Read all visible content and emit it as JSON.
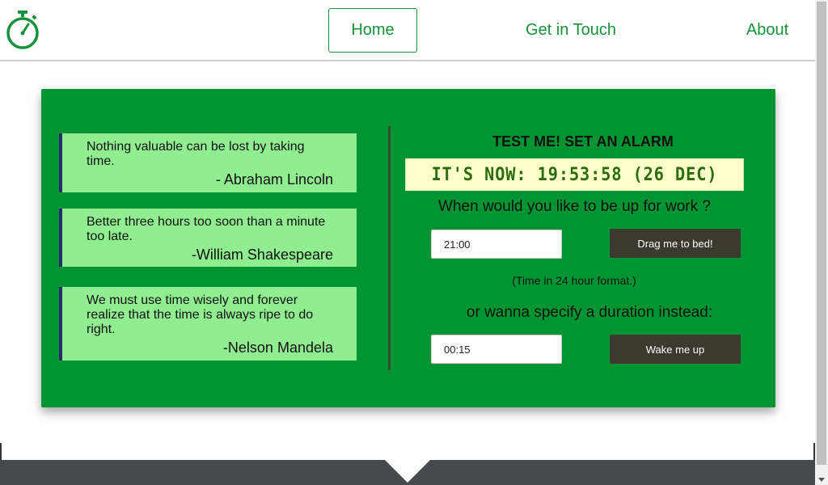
{
  "header": {
    "logo_icon": "stopwatch-icon",
    "nav": [
      {
        "label": "Home",
        "active": true
      },
      {
        "label": "Get in Touch"
      },
      {
        "label": "About"
      }
    ]
  },
  "quotes": [
    {
      "text": "Nothing valuable can be lost by taking time.",
      "author": "- Abraham Lincoln"
    },
    {
      "text": "Better three hours too soon than a minute too late.",
      "author": "-William Shakespeare"
    },
    {
      "text": "We must use time wisely and forever realize that the time is always ripe to do right.",
      "author": "-Nelson Mandela"
    }
  ],
  "alarm": {
    "title": "TEST ME! SET AN ALARM",
    "clock": "IT'S NOW: 19:53:58 (26 DEC)",
    "question": "When would you like to be up for work ?",
    "time_value": "21:00",
    "time_button": "Drag me to bed!",
    "hint": "(Time in 24 hour format.)",
    "duration_prompt": "or wanna specify a duration instead:",
    "duration_value": "00:15",
    "duration_button": "Wake me up"
  },
  "colors": {
    "brand_green": "#16933a",
    "card_green": "#009432",
    "quote_bg": "#90ee90",
    "button_dark": "#3b3a2e",
    "footer": "#444a50"
  }
}
